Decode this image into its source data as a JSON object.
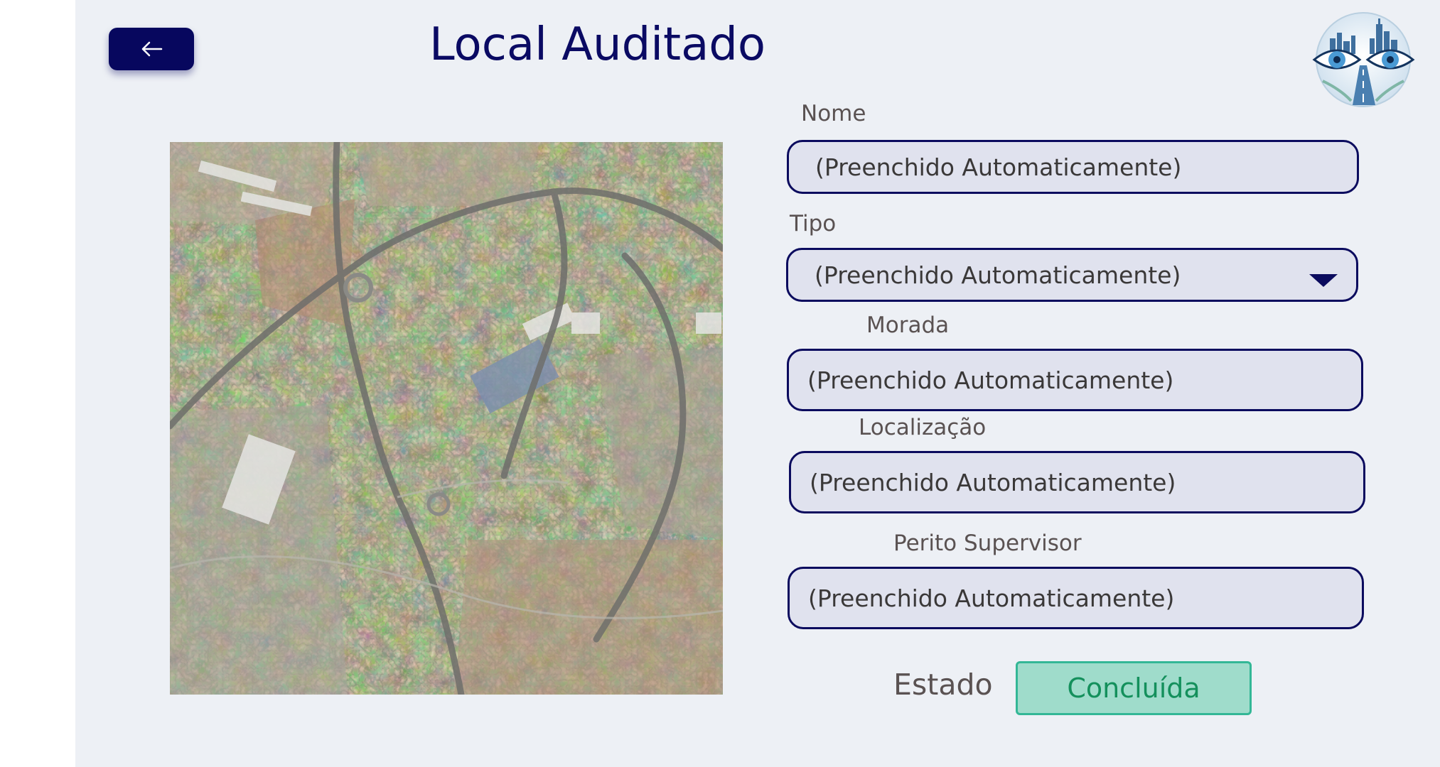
{
  "header": {
    "title": "Local Auditado",
    "back_icon": "arrow-left-icon"
  },
  "colors": {
    "primary": "#07075e",
    "background": "#edf0f5",
    "field_fill": "#e0e2ee",
    "status_fill": "#9fdccb",
    "status_text": "#14905c"
  },
  "form": {
    "nome": {
      "label": "Nome",
      "value": "(Preenchido Automaticamente)"
    },
    "tipo": {
      "label": "Tipo",
      "value": "(Preenchido Automaticamente)",
      "icon": "caret-down-icon"
    },
    "morada": {
      "label": "Morada",
      "value": "(Preenchido Automaticamente)"
    },
    "localizacao": {
      "label": "Localização",
      "value": "(Preenchido Automaticamente)"
    },
    "perito": {
      "label": "Perito Supervisor",
      "value": "(Preenchido Automaticamente)"
    }
  },
  "status": {
    "label": "Estado",
    "value": "Concluída"
  }
}
